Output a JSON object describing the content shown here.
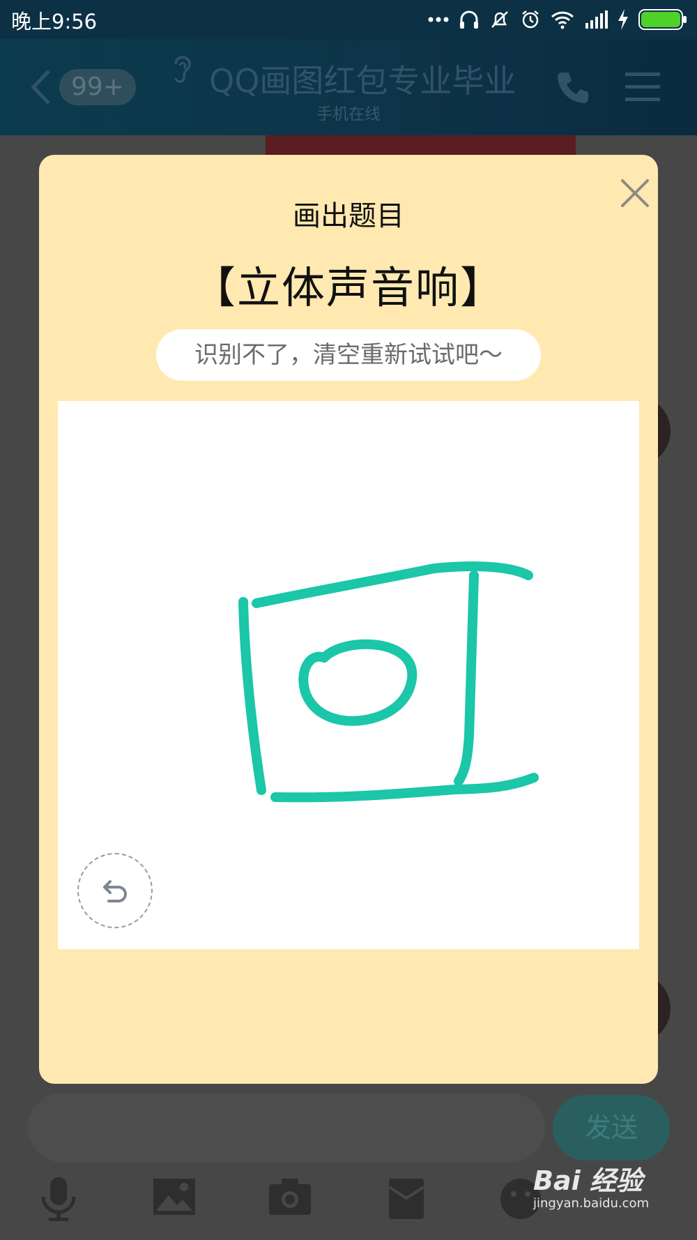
{
  "status_bar": {
    "time": "晚上9:56",
    "icons": [
      "more-dots-icon",
      "headset-icon",
      "mute-bell-icon",
      "alarm-icon",
      "wifi-icon",
      "signal-icon",
      "charging-icon",
      "battery-icon"
    ]
  },
  "header": {
    "badge": "99+",
    "title": "QQ画图红包专业毕业",
    "subtitle": "手机在线",
    "icons": [
      "back-arrow-icon",
      "ear-icon",
      "phone-icon",
      "menu-icon"
    ]
  },
  "dialog": {
    "title": "画出题目",
    "topic": "【立体声音响】",
    "hint": "识别不了，清空重新试试吧～",
    "icons": [
      "close-icon",
      "undo-icon"
    ],
    "stroke_color": "#1bc6a9"
  },
  "input_bar": {
    "send_label": "发送",
    "tool_icons": [
      "microphone-icon",
      "image-icon",
      "camera-icon",
      "red-packet-icon",
      "emoji-icon"
    ]
  },
  "watermark": {
    "logo": "Bai 经验",
    "url": "jingyan.baidu.com"
  },
  "colors": {
    "dialog_bg": "#ffe9b1",
    "header_bg": "#0d3347",
    "overlay": "#474747",
    "accent": "#1bc6a9"
  }
}
